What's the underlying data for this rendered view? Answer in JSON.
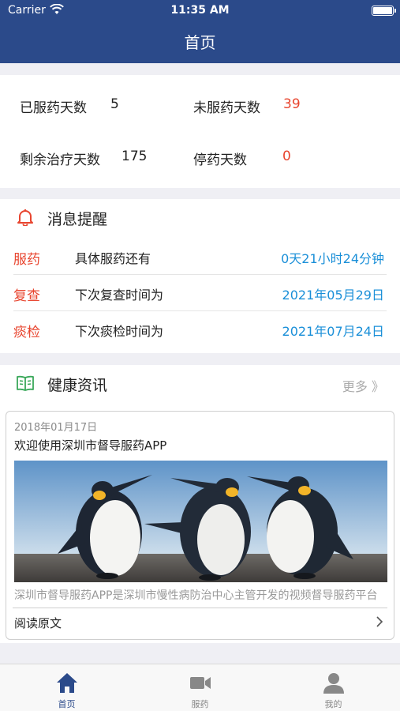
{
  "status_bar": {
    "carrier": "Carrier",
    "time": "11:35 AM"
  },
  "nav": {
    "title": "首页"
  },
  "stats": {
    "taken_days": {
      "label": "已服药天数",
      "value": "5"
    },
    "missed_days": {
      "label": "未服药天数",
      "value": "39"
    },
    "remaining_days": {
      "label": "剩余治疗天数",
      "value": "175"
    },
    "stopped_days": {
      "label": "停药天数",
      "value": "0"
    }
  },
  "reminder": {
    "title": "消息提醒",
    "rows": [
      {
        "tag": "服药",
        "desc": "具体服药还有",
        "value": "0天21小时24分钟"
      },
      {
        "tag": "复查",
        "desc": "下次复查时间为",
        "value": "2021年05月29日"
      },
      {
        "tag": "痰检",
        "desc": "下次痰检时间为",
        "value": "2021年07月24日"
      }
    ]
  },
  "news": {
    "title": "健康资讯",
    "more": "更多 》",
    "article": {
      "date": "2018年01月17日",
      "title": "欢迎使用深圳市督导服药APP",
      "summary": "深圳市督导服药APP是深圳市慢性病防治中心主管开发的视频督导服药平台",
      "read_label": "阅读原文"
    }
  },
  "tabbar": {
    "items": [
      {
        "label": "首页",
        "icon": "home-icon",
        "active": true
      },
      {
        "label": "服药",
        "icon": "video-camera-icon",
        "active": false
      },
      {
        "label": "我的",
        "icon": "user-icon",
        "active": false
      }
    ]
  },
  "colors": {
    "brand": "#2b4a8a",
    "alert": "#e8452f",
    "link": "#1a8fd8"
  }
}
